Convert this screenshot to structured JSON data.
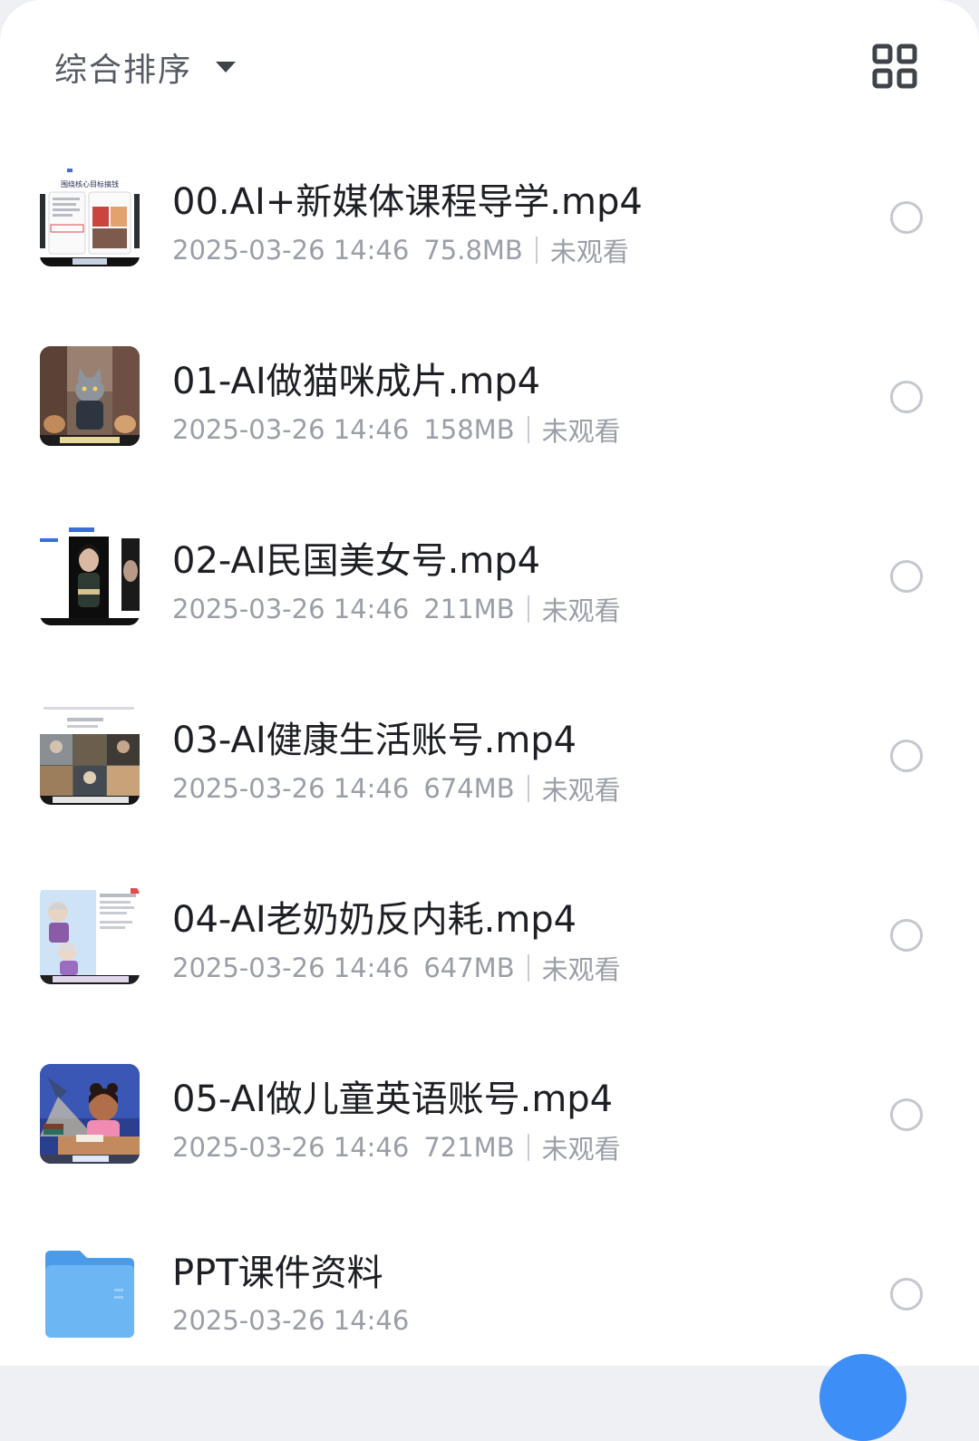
{
  "toolbar": {
    "sort_label": "综合排序",
    "sort_icon": "caret-down-icon",
    "view_toggle_icon": "grid-view-icon"
  },
  "files": [
    {
      "title": "00.AI+新媒体课程导学.mp4",
      "date": "2025-03-26 14:46",
      "size": "75.8MB",
      "status": "未观看",
      "thumb_caption": "围绕核心目标搞钱"
    },
    {
      "title": "01-AI做猫咪成片.mp4",
      "date": "2025-03-26 14:46",
      "size": "158MB",
      "status": "未观看"
    },
    {
      "title": "02-AI民国美女号.mp4",
      "date": "2025-03-26 14:46",
      "size": "211MB",
      "status": "未观看"
    },
    {
      "title": "03-AI健康生活账号.mp4",
      "date": "2025-03-26 14:46",
      "size": "674MB",
      "status": "未观看"
    },
    {
      "title": "04-AI老奶奶反内耗.mp4",
      "date": "2025-03-26 14:46",
      "size": "647MB",
      "status": "未观看"
    },
    {
      "title": "05-AI做儿童英语账号.mp4",
      "date": "2025-03-26 14:46",
      "size": "721MB",
      "status": "未观看"
    }
  ],
  "folder": {
    "title": "PPT课件资料",
    "date": "2025-03-26 14:46",
    "icon": "folder-icon"
  },
  "colors": {
    "accent": "#3e8ef7",
    "text_primary": "#1d1f24",
    "text_secondary": "#9a9ea6",
    "folder": "#5aa9f0"
  }
}
